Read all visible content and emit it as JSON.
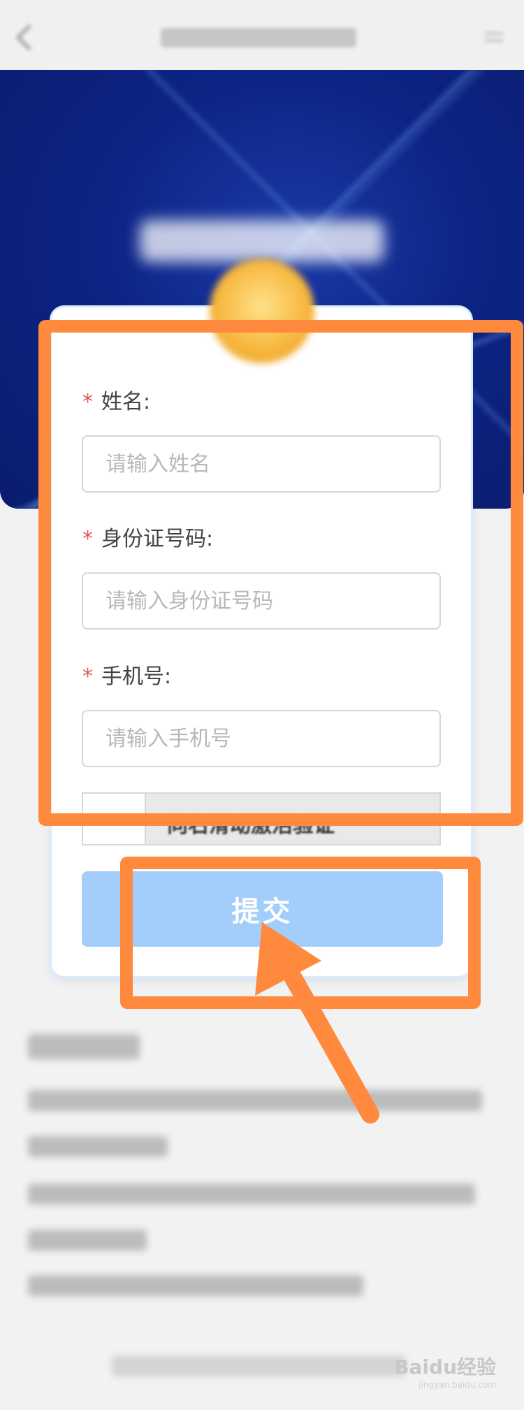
{
  "form": {
    "name_label": "姓名:",
    "name_placeholder": "请输入姓名",
    "id_label": "身份证号码:",
    "id_placeholder": "请输入身份证号码",
    "phone_label": "手机号:",
    "phone_placeholder": "请输入手机号",
    "required_mark": "*",
    "slider_text": "向右滑动激活验证",
    "submit_label": "提交"
  },
  "watermark": {
    "brand": "Baidu经验",
    "url": "jingyan.baidu.com"
  },
  "colors": {
    "annotation": "#ff8a3d",
    "submit_bg": "#a3cdfb",
    "hero_bg": "#0d2485",
    "required": "#e05757"
  }
}
